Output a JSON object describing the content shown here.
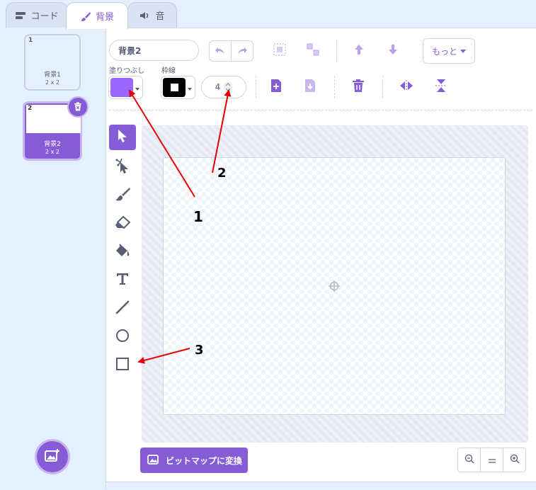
{
  "tabs": [
    {
      "label": "コード",
      "icon": "code-icon"
    },
    {
      "label": "背景",
      "icon": "brush-icon"
    },
    {
      "label": "音",
      "icon": "speaker-icon"
    }
  ],
  "backdrops": [
    {
      "number": "1",
      "name": "背景1",
      "size": "2 x 2"
    },
    {
      "number": "2",
      "name": "背景2",
      "size": "2 x 2"
    }
  ],
  "toolbar": {
    "costume_name": "背景2",
    "fill_label": "塗りつぶし",
    "outline_label": "枠線",
    "outline_width": "4",
    "more_label": "もっと",
    "fill_color": "#9966ff",
    "outline_color": "#000000"
  },
  "bottom": {
    "convert_label": "ビットマップに変換"
  },
  "annotations": [
    "1",
    "2",
    "3"
  ],
  "colors": {
    "accent": "#855cd6",
    "arrow": "#e60000"
  }
}
